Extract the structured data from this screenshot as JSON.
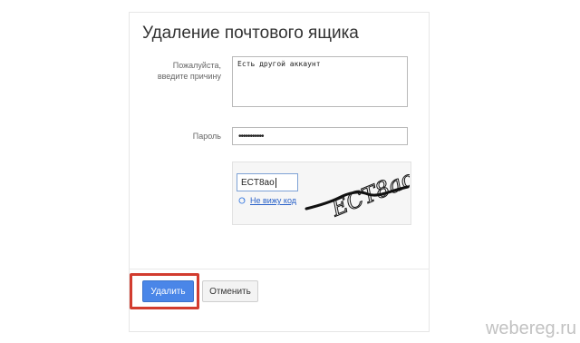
{
  "title": "Удаление почтового ящика",
  "reason": {
    "label_line1": "Пожалуйста,",
    "label_line2": "введите причину",
    "value": "Есть другой аккаунт"
  },
  "password": {
    "label": "Пароль",
    "value_masked": "•••••••••••"
  },
  "captcha": {
    "input_value": "ECT8ao",
    "no_code_link": "Не вижу код",
    "image_text": "ECT8ao"
  },
  "buttons": {
    "delete": "Удалить",
    "cancel": "Отменить"
  },
  "watermark": "webereg.ru",
  "colors": {
    "primary_button": "#4a86e8",
    "highlight_frame": "#d23c2f",
    "link": "#2a62c9"
  }
}
